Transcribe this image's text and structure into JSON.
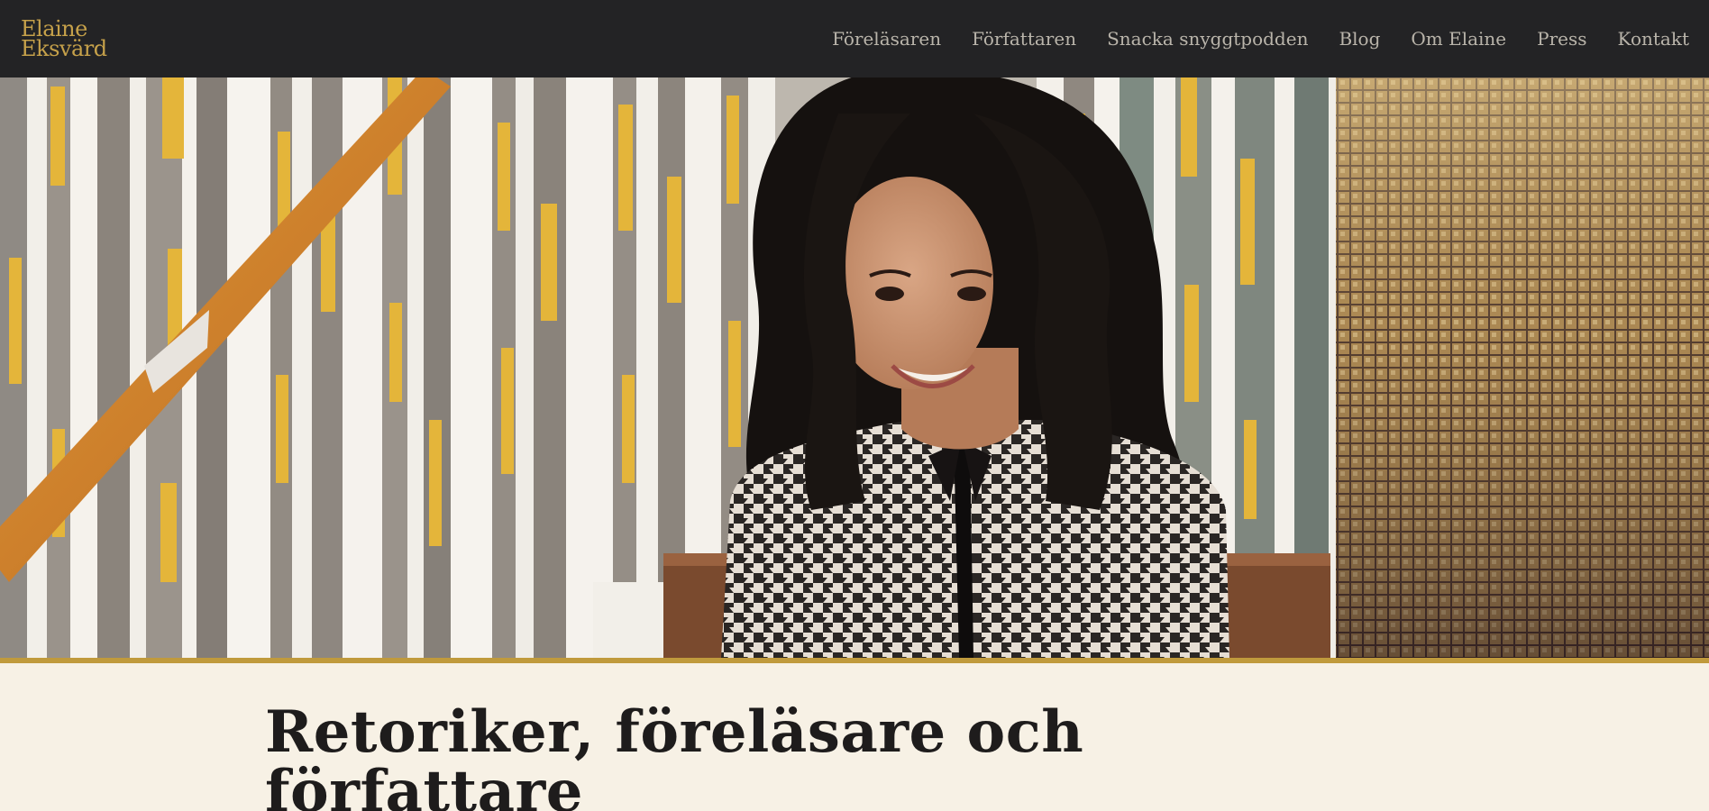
{
  "site": {
    "logo_line1": "Elaine",
    "logo_line2": "Eksvärd"
  },
  "nav": {
    "items": [
      {
        "label": "Föreläsaren"
      },
      {
        "label": "Författaren"
      },
      {
        "label": "Snacka snyggtpodden"
      },
      {
        "label": "Blog"
      },
      {
        "label": "Om Elaine"
      },
      {
        "label": "Press"
      },
      {
        "label": "Kontakt"
      }
    ]
  },
  "hero": {
    "headline": "Retoriker, föreläsare och författare"
  },
  "colors": {
    "topbar": "#232325",
    "brand_gold": "#c6a14a",
    "nav_text": "#b9b4aa",
    "accent_line": "#c09a3c",
    "page_background": "#f7f1e5",
    "headline_text": "#1e1c1c"
  }
}
